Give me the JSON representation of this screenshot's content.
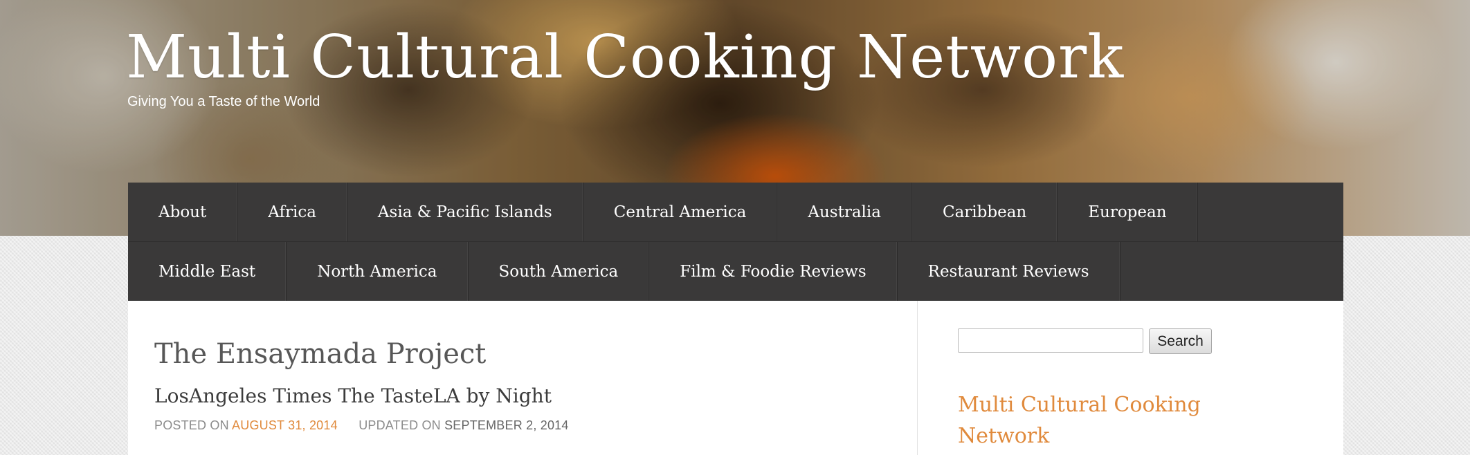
{
  "header": {
    "site_title": "Multi Cultural Cooking Network",
    "tagline": "Giving You a Taste of the World"
  },
  "nav": {
    "row1": [
      {
        "label": "About"
      },
      {
        "label": "Africa"
      },
      {
        "label": "Asia & Pacific Islands"
      },
      {
        "label": "Central America"
      },
      {
        "label": "Australia"
      },
      {
        "label": "Caribbean"
      },
      {
        "label": "European"
      }
    ],
    "row2": [
      {
        "label": "Middle East"
      },
      {
        "label": "North America"
      },
      {
        "label": "South America"
      },
      {
        "label": "Film & Foodie Reviews"
      },
      {
        "label": "Restaurant Reviews"
      }
    ]
  },
  "article": {
    "title": "The Ensaymada Project",
    "subtitle": "LosAngeles Times The TasteLA by Night",
    "meta": {
      "posted_label": "POSTED ON",
      "posted_date": "AUGUST 31, 2014",
      "updated_label": "UPDATED ON",
      "updated_date": "SEPTEMBER 2, 2014"
    }
  },
  "sidebar": {
    "search": {
      "value": "",
      "placeholder": "",
      "button_label": "Search"
    },
    "widget_title": "Multi Cultural Cooking Network"
  },
  "colors": {
    "nav_background": "#3a3939",
    "accent": "#e08a3c",
    "title_text": "#575757"
  }
}
